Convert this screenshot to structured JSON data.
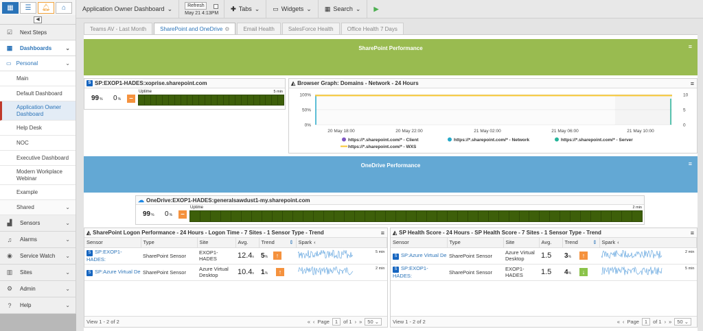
{
  "topbar": {
    "dashboard_label": "Application Owner Dashboard",
    "refresh_label": "Refresh",
    "refresh_time": "May 21 4:13PM",
    "tabs_label": "Tabs",
    "widgets_label": "Widgets",
    "search_label": "Search"
  },
  "sidebar": {
    "next_steps": "Next Steps",
    "dashboards": "Dashboards",
    "personal": "Personal",
    "personal_items": [
      "Main",
      "Default Dashboard",
      "Application Owner Dashboard",
      "Help Desk",
      "NOC",
      "Executive Dashboard",
      "Modern Workplace Webinar",
      "Example"
    ],
    "shared": "Shared",
    "sections": [
      "Sensors",
      "Alarms",
      "Service Watch",
      "Sites",
      "Admin",
      "Help"
    ]
  },
  "tabs": [
    "Teams AV - Last Month",
    "SharePoint and OneDrive",
    "Email Health",
    "SalesForce Health",
    "Office Health 7 Days"
  ],
  "colors": {
    "green": "#99bb50",
    "blue": "#63a8d4",
    "orange": "#f5923e",
    "dark_green": "#3d5f0a",
    "accent": "#2a73b8"
  },
  "sharepoint_banner": "SharePoint Performance",
  "onedrive_banner": "OneDrive Performance",
  "sp_sensor": {
    "title": "SP:EXOP1-HADES:xoprise.sharepoint.com",
    "pct1": "99",
    "pct2": "0",
    "unit": "%",
    "uptime_label": "Uptime",
    "interval": "5 min",
    "uptime_fraction": 1.0
  },
  "browser_graph": {
    "title": "Browser Graph: Domains - Network - 24 Hours",
    "chart_data": {
      "type": "line",
      "y_ticks_left": [
        "100%",
        "50%",
        "0%"
      ],
      "y_ticks_right": [
        "10",
        "5",
        "0"
      ],
      "x_ticks": [
        "20 May 18:00",
        "20 May 22:00",
        "21 May 02:00",
        "21 May 06:00",
        "21 May 10:00"
      ],
      "series": [
        {
          "name": "https://*.sharepoint.com/* - Client",
          "color": "#7e57c2"
        },
        {
          "name": "https://*.sharepoint.com/* - Network",
          "color": "#26a9c9"
        },
        {
          "name": "https://*.sharepoint.com/* - Server",
          "color": "#26b59a"
        },
        {
          "name": "https://*.sharepoint.com/* - WXS",
          "color": "#f7c631",
          "values": [
            97,
            97,
            97,
            97,
            97
          ]
        }
      ]
    }
  },
  "od_sensor": {
    "title": "OneDrive:EXOP1-HADES:generalsawdust1-my.sharepoint.com",
    "pct1": "99",
    "pct2": "0",
    "unit": "%",
    "uptime_label": "Uptime",
    "interval": "2 min",
    "uptime_fraction": 1.0
  },
  "logon_table": {
    "title": "SharePoint Logon Performance - 24 Hours - Logon Time - 7 Sites - 1 Sensor Type - Trend",
    "columns": [
      "Sensor",
      "Type",
      "Site",
      "Avg.",
      "Trend",
      "Spark"
    ],
    "rows": [
      {
        "sensor": "SP:EXOP1-HADES:",
        "type": "SharePoint Sensor",
        "site": "EXOP1-HADES",
        "avg": "12.4",
        "avg_unit": "s",
        "trend": "5",
        "trend_unit": "%",
        "interval": "5 min"
      },
      {
        "sensor": "SP:Azure Virtual De",
        "type": "SharePoint Sensor",
        "site": "Azure Virtual Desktop",
        "avg": "10.4",
        "avg_unit": "s",
        "trend": "1",
        "trend_unit": "%",
        "interval": "2 min"
      }
    ],
    "footer": "View 1 - 2 of 2",
    "page_label": "Page",
    "page": "1",
    "of": "of 1",
    "per_page": "50"
  },
  "health_table": {
    "title": "SP Health Score - 24 Hours - SP Health Score - 7 Sites - 1 Sensor Type - Trend",
    "columns": [
      "Sensor",
      "Type",
      "Site",
      "Avg.",
      "Trend",
      "Spark"
    ],
    "rows": [
      {
        "sensor": "SP:Azure Virtual De",
        "type": "SharePoint Sensor",
        "site": "Azure Virtual Desktop",
        "avg": "1.5",
        "trend": "3",
        "trend_unit": "%",
        "interval": "2 min"
      },
      {
        "sensor": "SP:EXOP1-HADES:",
        "type": "SharePoint Sensor",
        "site": "EXOP1-HADES",
        "avg": "1.5",
        "trend": "4",
        "trend_unit": "%",
        "interval": "5 min"
      }
    ],
    "footer": "View 1 - 2 of 2",
    "page_label": "Page",
    "page": "1",
    "of": "of 1",
    "per_page": "50"
  }
}
